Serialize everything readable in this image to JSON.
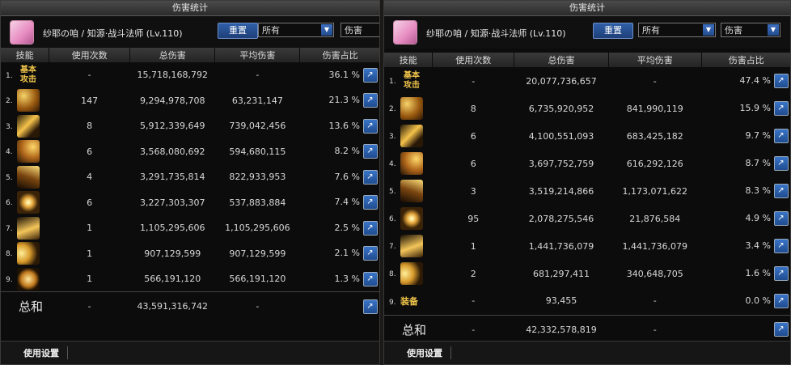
{
  "left": {
    "window_title": "伤害统计",
    "character": "纱耶の咱 / 知源·战斗法师 (Lv.110)",
    "reset_label": "重置",
    "filter_value": "所有",
    "mode_value": "伤害",
    "columns": [
      "技能",
      "使用次数",
      "总伤害",
      "平均伤害",
      "伤害占比"
    ],
    "rows": [
      {
        "idx": "1.",
        "icon": "basic-attack",
        "icon_text": "基本\n攻击",
        "uses": "-",
        "total": "15,718,168,792",
        "avg": "-",
        "pct": "36.1 %"
      },
      {
        "idx": "2.",
        "icon": "skill",
        "uses": "147",
        "total": "9,294,978,708",
        "avg": "63,231,147",
        "pct": "21.3 %"
      },
      {
        "idx": "3.",
        "icon": "skill",
        "uses": "8",
        "total": "5,912,339,649",
        "avg": "739,042,456",
        "pct": "13.6 %"
      },
      {
        "idx": "4.",
        "icon": "skill",
        "uses": "6",
        "total": "3,568,080,692",
        "avg": "594,680,115",
        "pct": "8.2 %"
      },
      {
        "idx": "5.",
        "icon": "skill",
        "uses": "4",
        "total": "3,291,735,814",
        "avg": "822,933,953",
        "pct": "7.6 %"
      },
      {
        "idx": "6.",
        "icon": "skill",
        "uses": "6",
        "total": "3,227,303,307",
        "avg": "537,883,884",
        "pct": "7.4 %"
      },
      {
        "idx": "7.",
        "icon": "skill",
        "uses": "1",
        "total": "1,105,295,606",
        "avg": "1,105,295,606",
        "pct": "2.5 %"
      },
      {
        "idx": "8.",
        "icon": "skill",
        "uses": "1",
        "total": "907,129,599",
        "avg": "907,129,599",
        "pct": "2.1 %"
      },
      {
        "idx": "9.",
        "icon": "skill",
        "uses": "1",
        "total": "566,191,120",
        "avg": "566,191,120",
        "pct": "1.3 %"
      }
    ],
    "total": {
      "label": "总和",
      "uses": "-",
      "total": "43,591,316,742",
      "avg": "-"
    },
    "footer_label": "使用设置"
  },
  "right": {
    "window_title": "伤害统计",
    "character": "纱耶の咱 / 知源·战斗法师 (Lv.110)",
    "reset_label": "重置",
    "filter_value": "所有",
    "mode_value": "伤害",
    "columns": [
      "技能",
      "使用次数",
      "总伤害",
      "平均伤害",
      "伤害占比"
    ],
    "rows": [
      {
        "idx": "1.",
        "icon": "basic-attack",
        "icon_text": "基本\n攻击",
        "uses": "-",
        "total": "20,077,736,657",
        "avg": "-",
        "pct": "47.4 %"
      },
      {
        "idx": "2.",
        "icon": "skill",
        "uses": "8",
        "total": "6,735,920,952",
        "avg": "841,990,119",
        "pct": "15.9 %"
      },
      {
        "idx": "3.",
        "icon": "skill",
        "uses": "6",
        "total": "4,100,551,093",
        "avg": "683,425,182",
        "pct": "9.7 %"
      },
      {
        "idx": "4.",
        "icon": "skill",
        "uses": "6",
        "total": "3,697,752,759",
        "avg": "616,292,126",
        "pct": "8.7 %"
      },
      {
        "idx": "5.",
        "icon": "skill",
        "uses": "3",
        "total": "3,519,214,866",
        "avg": "1,173,071,622",
        "pct": "8.3 %"
      },
      {
        "idx": "6.",
        "icon": "skill",
        "uses": "95",
        "total": "2,078,275,546",
        "avg": "21,876,584",
        "pct": "4.9 %"
      },
      {
        "idx": "7.",
        "icon": "skill",
        "uses": "1",
        "total": "1,441,736,079",
        "avg": "1,441,736,079",
        "pct": "3.4 %"
      },
      {
        "idx": "8.",
        "icon": "skill",
        "uses": "2",
        "total": "681,297,411",
        "avg": "340,648,705",
        "pct": "1.6 %"
      },
      {
        "idx": "9.",
        "icon": "equipment",
        "icon_text": "装备",
        "uses": "-",
        "total": "93,455",
        "avg": "-",
        "pct": "0.0 %"
      }
    ],
    "total": {
      "label": "总和",
      "uses": "-",
      "total": "42,332,578,819",
      "avg": "-"
    },
    "footer_label": "使用设置"
  }
}
